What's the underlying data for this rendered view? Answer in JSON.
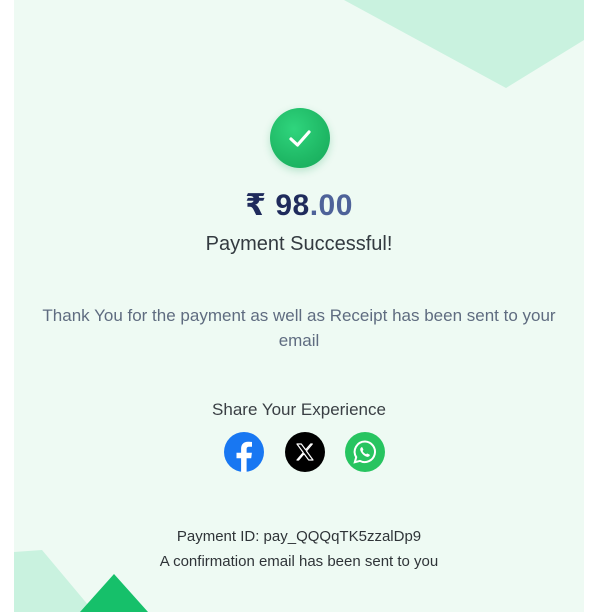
{
  "payment": {
    "currency_symbol": "₹",
    "amount_whole": "98",
    "amount_fraction": ".00",
    "status": "Payment Successful!",
    "message": "Thank You for the payment as well as Receipt has been sent to your email"
  },
  "share": {
    "title": "Share Your Experience",
    "icons": [
      "facebook-icon",
      "x-icon",
      "whatsapp-icon"
    ]
  },
  "footer": {
    "payment_id": "Payment ID: pay_QQQqTK5zzalDp9",
    "confirmation": "A confirmation email has been sent to you"
  },
  "colors": {
    "background": "#eefaf3",
    "accent_green": "#1fb865",
    "amount_text": "#1f2b5c",
    "facebook_blue": "#1877f2",
    "whatsapp_green": "#27c460"
  }
}
